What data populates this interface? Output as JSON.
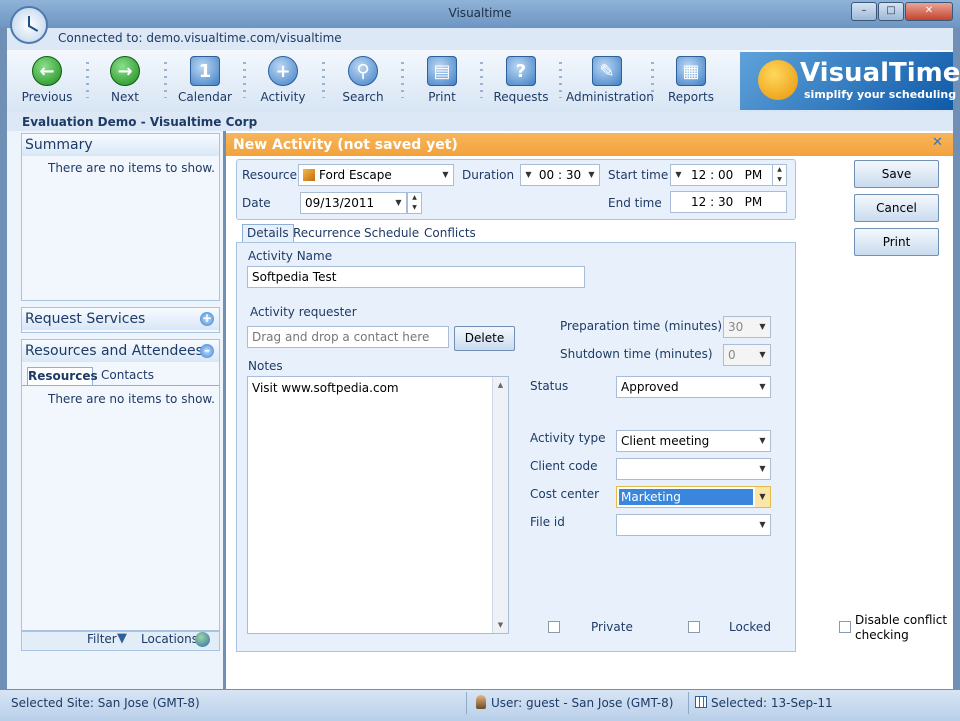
{
  "window": {
    "title": "Visualtime",
    "minimize": "0",
    "maximize": "1",
    "close": "r"
  },
  "connection": {
    "text": "Connected to: demo.visualtime.com/visualtime"
  },
  "toolbar": {
    "items": [
      {
        "label": "Previous"
      },
      {
        "label": "Next"
      },
      {
        "label": "Calendar"
      },
      {
        "label": "Activity"
      },
      {
        "label": "Search"
      },
      {
        "label": "Print"
      },
      {
        "label": "Requests"
      },
      {
        "label": "Administration"
      },
      {
        "label": "Reports"
      }
    ]
  },
  "logo": {
    "brand": "VisualTime",
    "tagline": "simplify your scheduling"
  },
  "org": {
    "text": "Evaluation Demo  - Visualtime Corp"
  },
  "left": {
    "summary_title": "Summary",
    "summary_empty": "There are no items to show.",
    "request_services": "Request Services",
    "resources_title": "Resources and Attendees",
    "tabs": [
      "Resources",
      "Contacts"
    ],
    "resources_empty": "There are no items to show.",
    "filter": "Filter",
    "locations": "Locations"
  },
  "activity": {
    "title": "New Activity (not saved yet)",
    "resource_label": "Resource",
    "resource_value": "Ford Escape",
    "duration_label": "Duration",
    "duration_value": "00 : 30",
    "start_label": "Start time",
    "start_value": "12 : 00",
    "start_ampm": "PM",
    "date_label": "Date",
    "date_value": "09/13/2011",
    "end_label": "End time",
    "end_value": "12 : 30",
    "end_ampm": "PM",
    "tabs": [
      "Details",
      "Recurrence",
      "Schedule",
      "Conflicts"
    ],
    "name_label": "Activity Name",
    "name_value": "Softpedia Test",
    "requester_label": "Activity requester",
    "requester_placeholder": "Drag and drop a contact here",
    "delete": "Delete",
    "notes_label": "Notes",
    "notes_value": "Visit www.softpedia.com",
    "prep_label": "Preparation time (minutes)",
    "prep_value": "30",
    "shutdown_label": "Shutdown time (minutes)",
    "shutdown_value": "0",
    "status_label": "Status",
    "status_value": "Approved",
    "type_label": "Activity type",
    "type_value": "Client meeting",
    "client_label": "Client code",
    "client_value": "",
    "cost_label": "Cost center",
    "cost_value": "Marketing",
    "file_label": "File id",
    "file_value": "",
    "private": "Private",
    "locked": "Locked",
    "disable_conflict_1": "Disable conflict",
    "disable_conflict_2": "checking"
  },
  "buttons": {
    "save": "Save",
    "cancel": "Cancel",
    "print": "Print"
  },
  "status": {
    "site": "Selected Site: San Jose (GMT-8)",
    "user": "User: guest - San Jose (GMT-8)",
    "selected": "Selected: 13-Sep-11"
  },
  "colors": {
    "accent": "#f2a23b",
    "panel": "#e8f1fb",
    "selection": "#3a86dc"
  }
}
